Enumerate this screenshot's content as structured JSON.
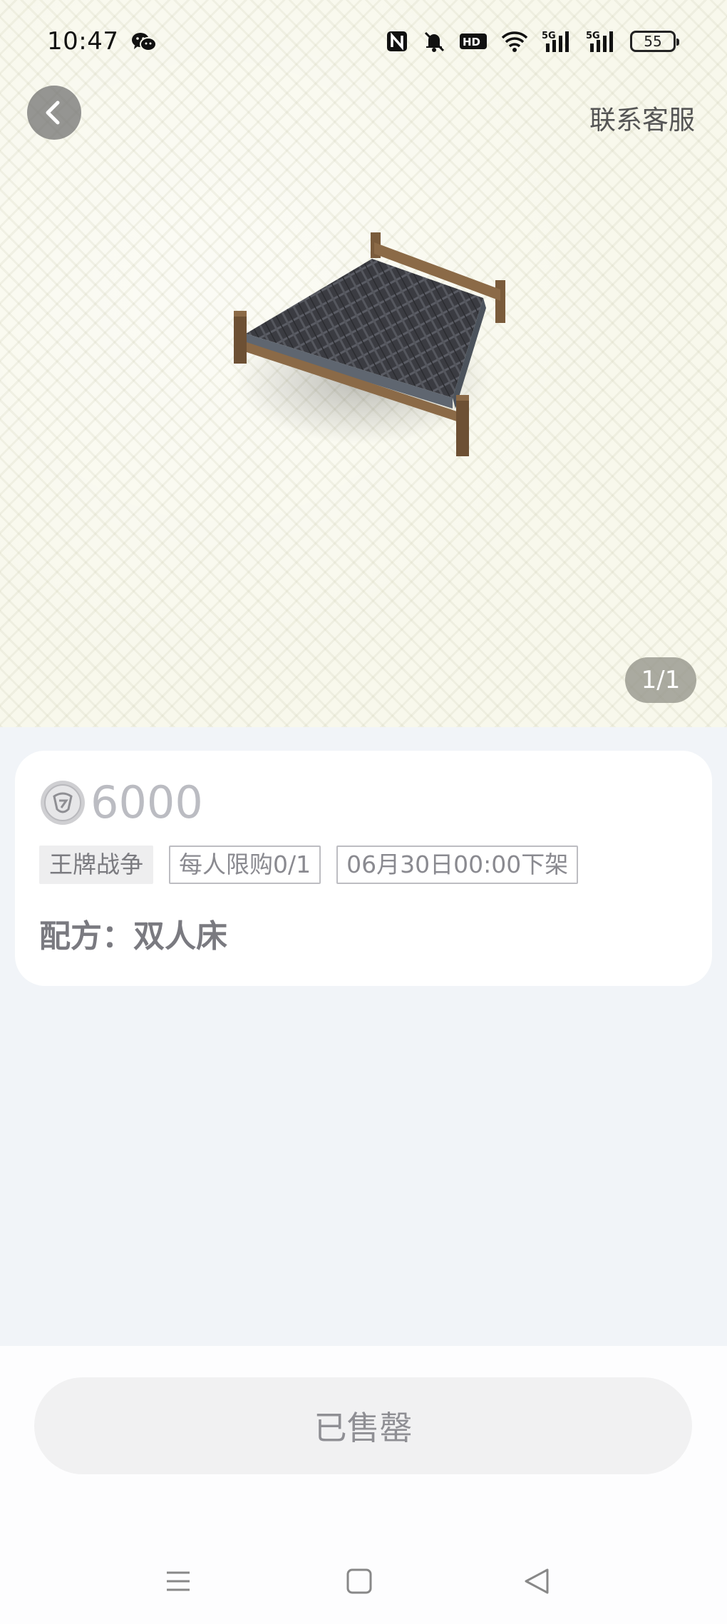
{
  "status_bar": {
    "time": "10:47",
    "left_icons": [
      "wechat-icon"
    ],
    "right_icons": [
      "nfc-icon",
      "mute-icon",
      "hd-icon",
      "wifi-icon",
      "signal-5g-icon",
      "signal-5g-icon"
    ],
    "battery": "55"
  },
  "header": {
    "back_icon": "chevron-left-icon",
    "contact_label": "联系客服"
  },
  "gallery": {
    "image_icon": "double-bed-image",
    "page_indicator": "1/1"
  },
  "product": {
    "currency_icon": "silver-coin-icon",
    "price": "6000",
    "tags": [
      "王牌战争",
      "每人限购0/1",
      "06月30日00:00下架"
    ],
    "recipe_label": "配方：双人床"
  },
  "actions": {
    "sold_out_label": "已售罄"
  },
  "system_nav": {
    "icons": [
      "menu-icon",
      "home-icon",
      "back-triangle-icon"
    ]
  }
}
